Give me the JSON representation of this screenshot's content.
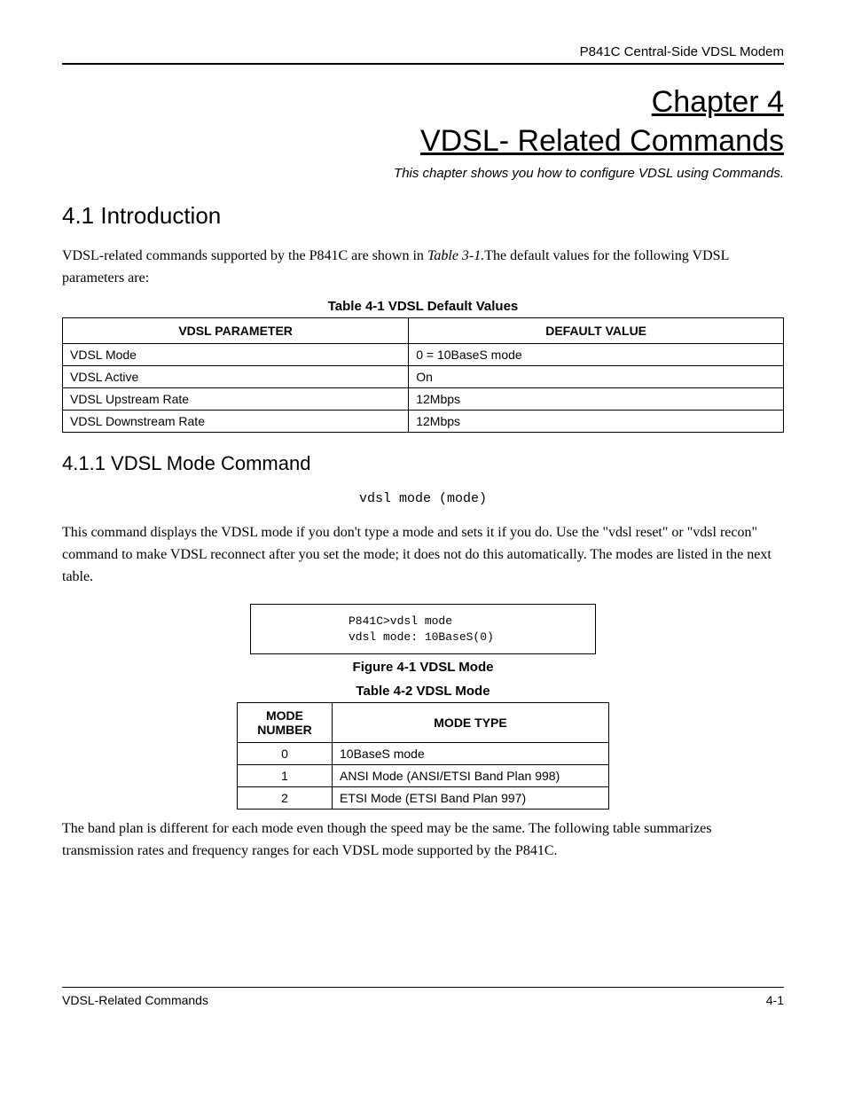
{
  "header": {
    "right": "P841C Central-Side VDSL Modem"
  },
  "chapter": {
    "line1": "Chapter 4",
    "line2": "VDSL- Related Commands",
    "subtitle": "This chapter shows you how to configure VDSL using Commands."
  },
  "section_4_1": {
    "heading": "4.1  Introduction",
    "para_prefix": "VDSL-related commands supported by the P841C are shown in ",
    "para_italic": "Table 3-1.",
    "para_suffix": "The default values for the following VDSL parameters are:"
  },
  "table_4_1": {
    "caption": "Table 4-1 VDSL Default Values",
    "headers": [
      "VDSL PARAMETER",
      "DEFAULT VALUE"
    ],
    "rows": [
      [
        "VDSL Mode",
        "0 = 10BaseS mode"
      ],
      [
        "VDSL Active",
        "On"
      ],
      [
        "VDSL Upstream Rate",
        "12Mbps"
      ],
      [
        "VDSL Downstream Rate",
        "12Mbps"
      ]
    ]
  },
  "section_4_1_1": {
    "heading": "4.1.1   VDSL Mode Command",
    "code": "vdsl mode (mode)",
    "para": "This command displays the VDSL mode if you don't type a mode and sets it if you do. Use the \"vdsl reset\" or \"vdsl recon\" command to make VDSL reconnect after you set the mode; it does not do this automatically. The modes are listed in the next table."
  },
  "terminal": {
    "line1": "P841C>vdsl mode",
    "line2": "vdsl mode: 10BaseS(0)"
  },
  "figure_4_1": {
    "caption": "Figure 4-1 VDSL Mode"
  },
  "table_4_2": {
    "caption": "Table 4-2 VDSL Mode",
    "headers": [
      "MODE NUMBER",
      "MODE TYPE"
    ],
    "rows": [
      [
        "0",
        "10BaseS mode"
      ],
      [
        "1",
        "ANSI Mode (ANSI/ETSI Band Plan 998)"
      ],
      [
        "2",
        "ETSI Mode (ETSI Band Plan 997)"
      ]
    ]
  },
  "closing_para": "The band plan is different for each mode even though the speed may be the same. The following table summarizes transmission rates and frequency ranges for each VDSL mode supported by the P841C.",
  "footer": {
    "left": "VDSL-Related Commands",
    "right": "4-1"
  }
}
